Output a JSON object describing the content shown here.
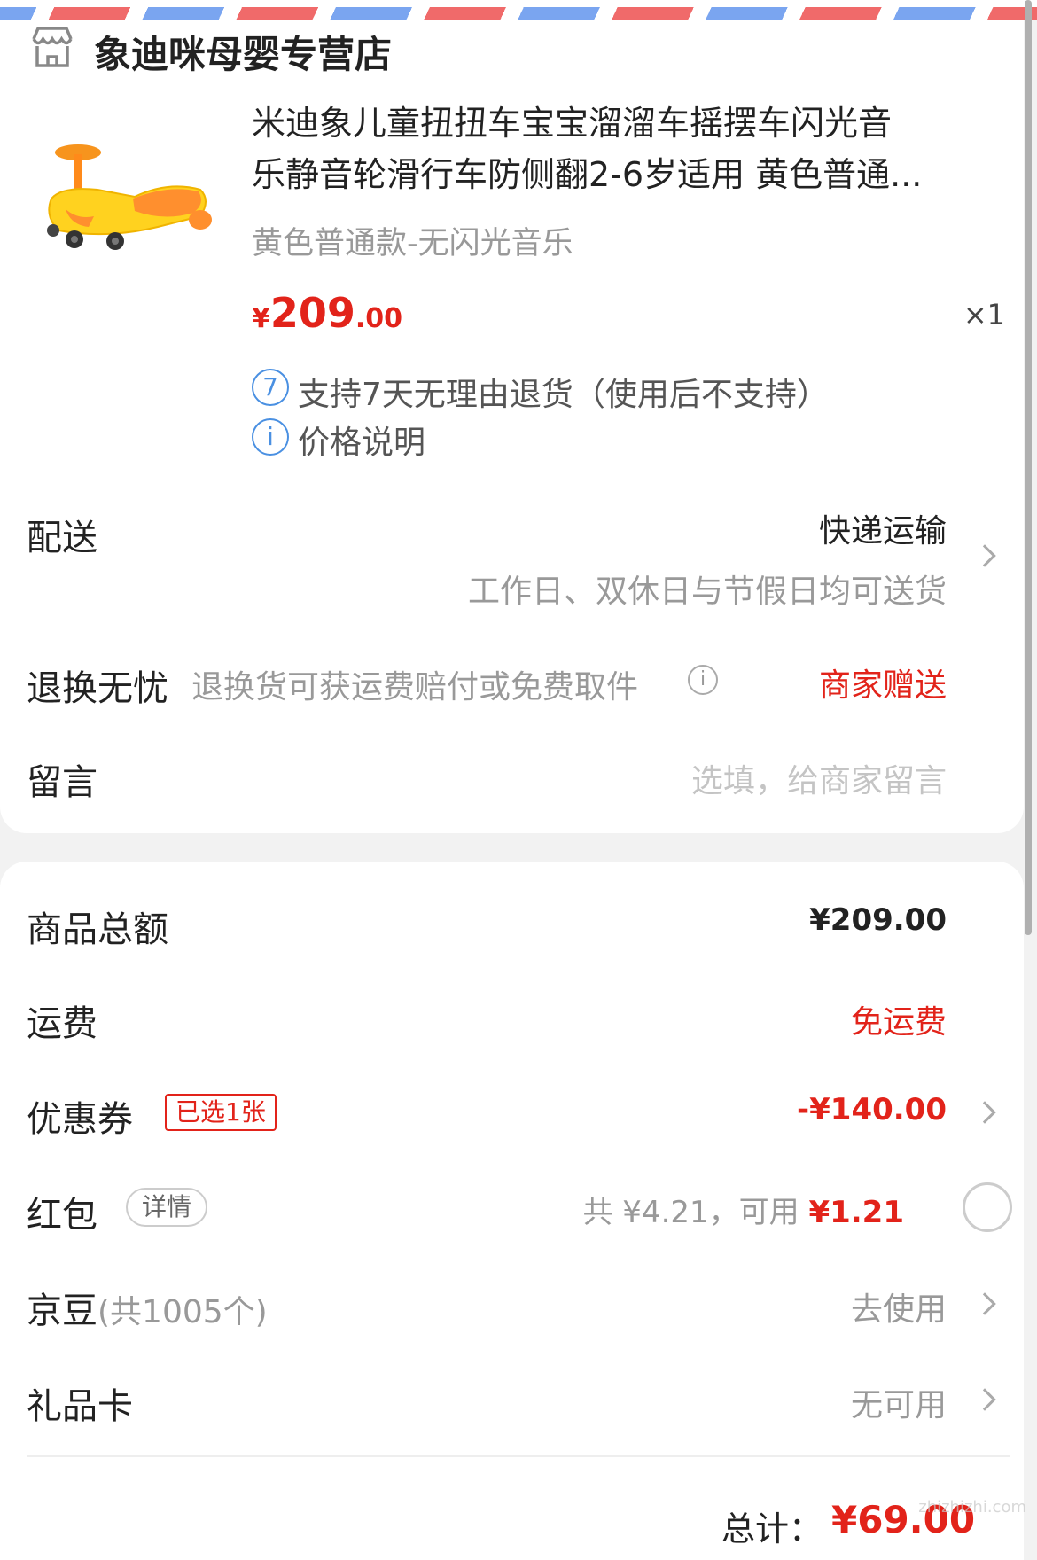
{
  "store": {
    "name": "象迪咪母婴专营店",
    "icon": "store-icon"
  },
  "product": {
    "title_line1": "米迪象儿童扭扭车宝宝溜溜车摇摆车闪光音",
    "title_line2": "乐静音轮滑行车防侧翻2-6岁适用 黄色普通...",
    "variant": "黄色普通款-无闪光音乐",
    "price_currency": "¥",
    "price_int": "209",
    "price_dec": ".00",
    "quantity": "×1",
    "service_return_icon_text": "7",
    "service_return": "支持7天无理由退货（使用后不支持）",
    "service_price_icon_text": "i",
    "service_price": "价格说明"
  },
  "delivery": {
    "label": "配送",
    "method": "快递运输",
    "note": "工作日、双休日与节假日均可送货"
  },
  "return_worry_free": {
    "label": "退换无忧",
    "desc": "退换货可获运费赔付或免费取件",
    "info_icon_text": "i",
    "status": "商家赠送"
  },
  "message": {
    "label": "留言",
    "placeholder": "选填，给商家留言"
  },
  "summary": {
    "goods_total_label": "商品总额",
    "goods_total": "¥209.00",
    "shipping_label": "运费",
    "shipping": "免运费",
    "coupon_label": "优惠券",
    "coupon_tag": "已选1张",
    "coupon_value": "-¥140.00",
    "redpacket_label": "红包",
    "redpacket_tag": "详情",
    "redpacket_total": "共 ¥4.21，可用 ",
    "redpacket_available": "¥1.21",
    "jingdou_label": "京豆",
    "jingdou_count": "(共1005个)",
    "jingdou_action": "去使用",
    "giftcard_label": "礼品卡",
    "giftcard_status": "无可用",
    "total_label": "总计：",
    "total_value": "¥69.00"
  },
  "watermark": "zhizhizhi.com",
  "colors": {
    "accent_red": "#e2231a",
    "info_blue": "#4a90e2"
  }
}
